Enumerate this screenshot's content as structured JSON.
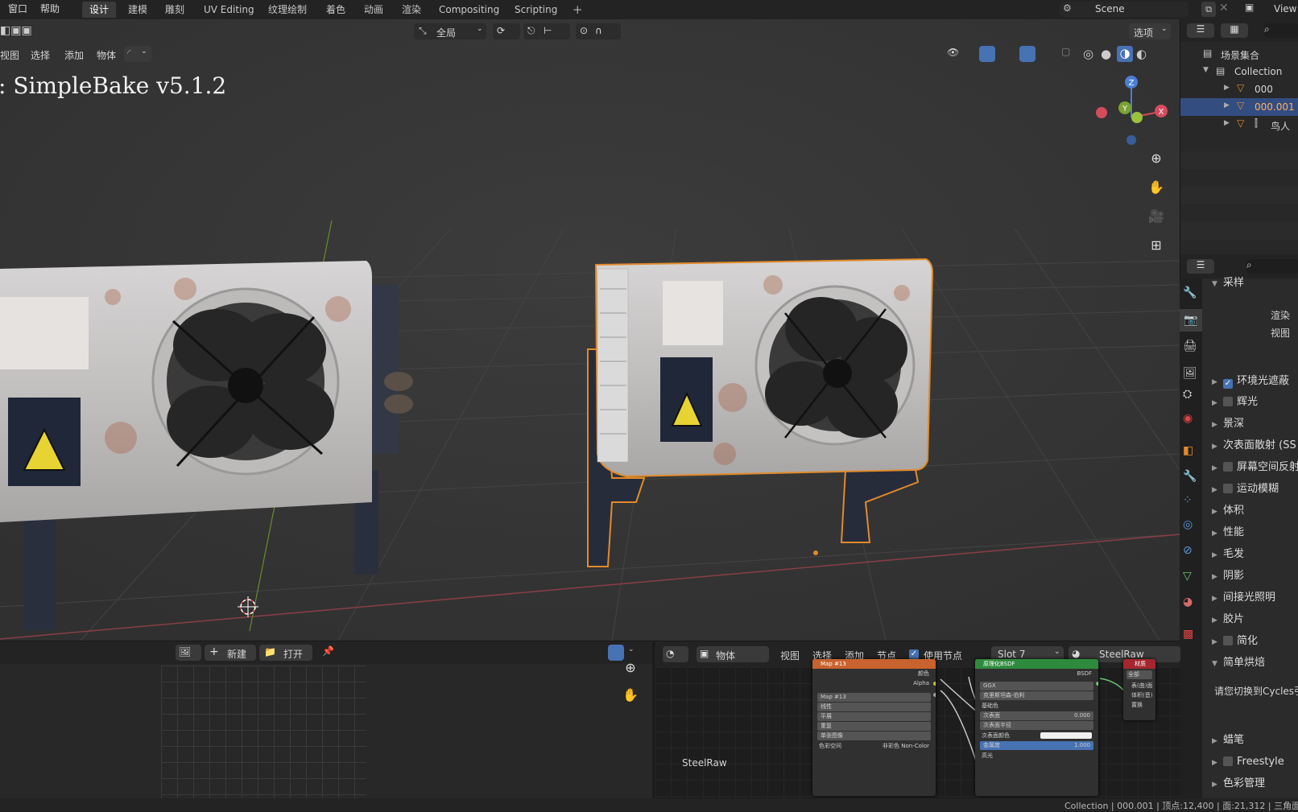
{
  "topbar": {
    "menus": [
      "窗口",
      "帮助"
    ],
    "workspaces": [
      "设计",
      "建模",
      "雕刻",
      "UV Editing",
      "纹理绘制",
      "着色",
      "动画",
      "渲染",
      "Compositing",
      "Scripting"
    ],
    "add_tab": "+",
    "scene": "Scene",
    "view_layer": "View"
  },
  "viewport": {
    "menus": [
      "视图",
      "选择",
      "添加",
      "物体"
    ],
    "transform_orientation": "全局",
    "options_label": "选项",
    "overlay_text": ": SimpleBake v5.1.2",
    "gizmo": {
      "x": "X",
      "y": "Y",
      "z": "Z"
    },
    "object_color": "#e28a2b"
  },
  "outliner": {
    "root": "场景集合",
    "collection": "Collection",
    "items": [
      "000",
      "000.001",
      "鸟人"
    ]
  },
  "properties": {
    "sections": [
      {
        "label": "采样",
        "open": true
      },
      {
        "label": "环境光遮蔽",
        "checkbox": true,
        "checked": true
      },
      {
        "label": "辉光",
        "checkbox": true,
        "checked": false
      },
      {
        "label": "景深"
      },
      {
        "label": "次表面散射 (SS"
      },
      {
        "label": "屏幕空间反射",
        "checkbox": true,
        "checked": false
      },
      {
        "label": "运动模糊",
        "checkbox": true,
        "checked": false
      },
      {
        "label": "体积"
      },
      {
        "label": "性能"
      },
      {
        "label": "毛发"
      },
      {
        "label": "阴影"
      },
      {
        "label": "间接光照明"
      },
      {
        "label": "胶片"
      },
      {
        "label": "简化",
        "checkbox": true,
        "checked": false
      },
      {
        "label": "简单烘焙",
        "open": true
      }
    ],
    "sampling_render": "渲染",
    "sampling_view": "视图",
    "simplebake_message": "请您切换到Cycles引",
    "bottom_sections": [
      {
        "label": "蜡笔"
      },
      {
        "label": "Freestyle",
        "checkbox": true,
        "checked": false
      },
      {
        "label": "色彩管理"
      }
    ]
  },
  "image_editor": {
    "new_label": "新建",
    "open_label": "打开"
  },
  "node_editor": {
    "mode": "物体",
    "menus": [
      "视图",
      "选择",
      "添加",
      "节点"
    ],
    "use_nodes_label": "使用节点",
    "use_nodes": true,
    "slot": "Slot 7",
    "material": "SteelRaw",
    "material_label": "SteelRaw",
    "image_node": {
      "title": "Map #13",
      "outputs": [
        "颜色",
        "Alpha"
      ],
      "image_name": "Map #13",
      "interpolation": "线性",
      "projection": "平展",
      "extension": "重复",
      "source": "单张图像",
      "colorspace_label": "色彩空间",
      "colorspace_value": "非彩色 Non-Color"
    },
    "bsdf_node": {
      "title": "原理化BSDF",
      "output": "BSDF",
      "distribution": "GGX",
      "subsurface_method": "克里斯坦森-伯利",
      "rows": [
        {
          "label": "基础色",
          "value": ""
        },
        {
          "label": "次表面",
          "value": "0.000"
        },
        {
          "label": "次表面半径",
          "value": ""
        },
        {
          "label": "次表面颜色",
          "value": ""
        },
        {
          "label": "金属度",
          "value": "1.000"
        },
        {
          "label": "高光",
          "value": ""
        }
      ]
    },
    "output_node": {
      "title": "材质",
      "target": "全部",
      "inputs": [
        "表(曲)面",
        "体积(音)",
        "置换"
      ]
    }
  },
  "statusbar": {
    "text": "Collection | 000.001 | 顶点:12,400 | 面:21,312 | 三角面"
  }
}
